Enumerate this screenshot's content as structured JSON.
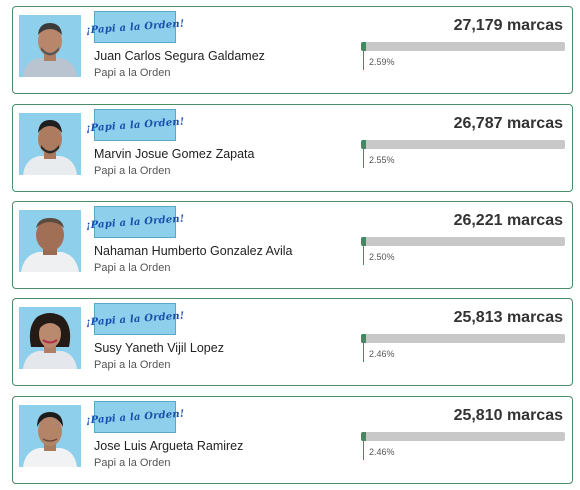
{
  "colors": {
    "card_border": "#4d8c6a",
    "bar_fill": "#3f8c62",
    "bar_track": "#c8c8c8",
    "photo_bg": "#8ed0ec",
    "logo_text": "#1b4fae"
  },
  "candidates": [
    {
      "logo_text": "¡Papi a la Orden!",
      "name": "Juan Carlos Segura Galdamez",
      "party": "Papi a la Orden",
      "votes": "27,179 marcas",
      "percent": "2.59%",
      "percent_value": 2.59,
      "photo_icon": "candidate-photo"
    },
    {
      "logo_text": "¡Papi a la Orden!",
      "name": "Marvin Josue Gomez Zapata",
      "party": "Papi a la Orden",
      "votes": "26,787 marcas",
      "percent": "2.55%",
      "percent_value": 2.55,
      "photo_icon": "candidate-photo"
    },
    {
      "logo_text": "¡Papi a la Orden!",
      "name": "Nahaman Humberto Gonzalez Avila",
      "party": "Papi a la Orden",
      "votes": "26,221 marcas",
      "percent": "2.50%",
      "percent_value": 2.5,
      "photo_icon": "candidate-photo"
    },
    {
      "logo_text": "¡Papi a la Orden!",
      "name": "Susy Yaneth Vijil Lopez",
      "party": "Papi a la Orden",
      "votes": "25,813 marcas",
      "percent": "2.46%",
      "percent_value": 2.46,
      "photo_icon": "candidate-photo"
    },
    {
      "logo_text": "¡Papi a la Orden!",
      "name": "Jose Luis Argueta Ramirez",
      "party": "Papi a la Orden",
      "votes": "25,810 marcas",
      "percent": "2.46%",
      "percent_value": 2.46,
      "photo_icon": "candidate-photo"
    }
  ]
}
